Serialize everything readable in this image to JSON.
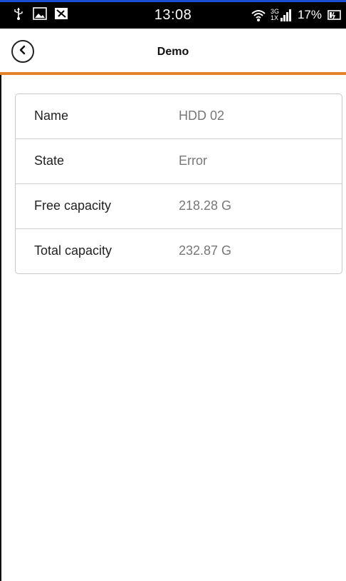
{
  "status_bar": {
    "time": "13:08",
    "battery_percent": "17%",
    "network_top": "3G",
    "network_bottom": "1X",
    "icons": [
      "usb-icon",
      "image-icon",
      "notification-icon",
      "wifi-icon",
      "signal-icon",
      "battery-icon"
    ]
  },
  "header": {
    "title": "Demo",
    "back_icon": "chevron-left-icon",
    "accent_color": "#e58229"
  },
  "details": [
    {
      "label": "Name",
      "value": "HDD 02"
    },
    {
      "label": "State",
      "value": "Error"
    },
    {
      "label": "Free capacity",
      "value": "218.28 G"
    },
    {
      "label": "Total capacity",
      "value": "232.87 G"
    }
  ]
}
